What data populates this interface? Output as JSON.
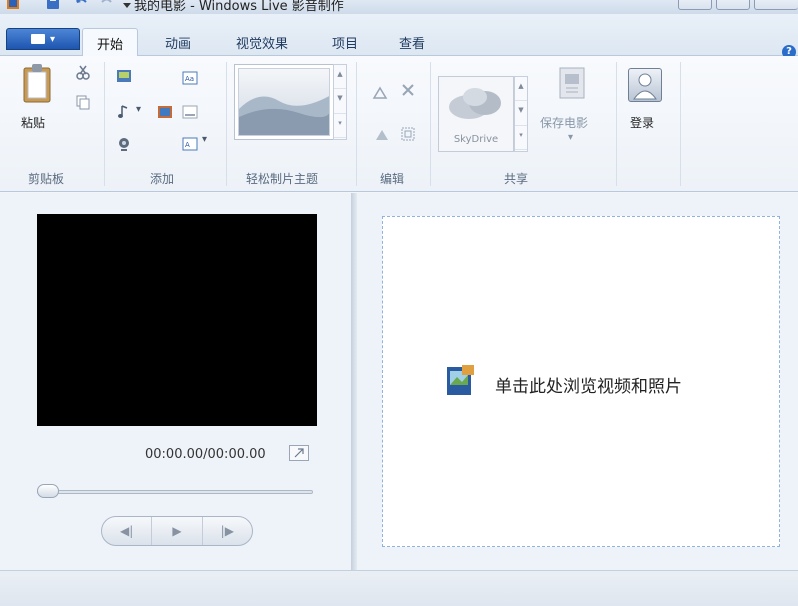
{
  "window": {
    "title": "我的电影 - Windows Live 影音制作"
  },
  "tabs": {
    "home": "开始",
    "animations": "动画",
    "visual_effects": "视觉效果",
    "project": "项目",
    "view": "查看"
  },
  "help": {
    "glyph": "?"
  },
  "ribbon": {
    "clipboard": {
      "paste_label": "粘贴",
      "group_label": "剪贴板"
    },
    "add": {
      "group_label": "添加"
    },
    "themes": {
      "group_label": "轻松制片主题"
    },
    "edit": {
      "group_label": "编辑"
    },
    "share": {
      "skydrive_label": "SkyDrive",
      "save_movie_label": "保存电影",
      "group_label": "共享"
    },
    "signin": {
      "label": "登录"
    }
  },
  "preview": {
    "timecode": "00:00.00/00:00.00",
    "progress": 0
  },
  "storyboard": {
    "browse_text": "单击此处浏览视频和照片"
  },
  "colors": {
    "accent": "#1d55b0",
    "drop_border": "#8fb3de",
    "video_bg": "#000000"
  }
}
